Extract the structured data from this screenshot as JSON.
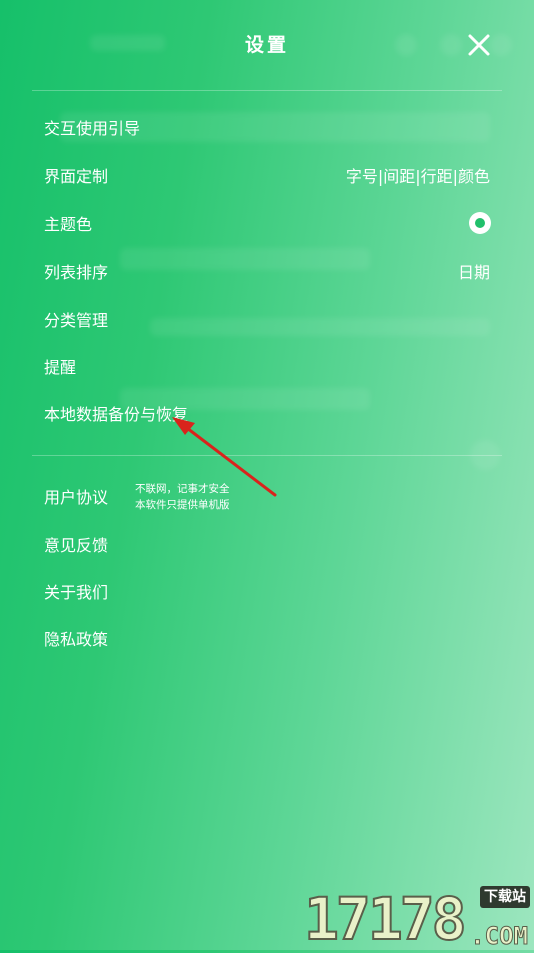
{
  "header": {
    "title": "设置"
  },
  "settings": {
    "items": [
      {
        "label": "交互使用引导",
        "value": ""
      },
      {
        "label": "界面定制",
        "value": "字号|间距|行距|颜色"
      },
      {
        "label": "主题色",
        "value": ""
      },
      {
        "label": "列表排序",
        "value": "日期"
      },
      {
        "label": "分类管理",
        "value": ""
      },
      {
        "label": "提醒",
        "value": ""
      },
      {
        "label": "本地数据备份与恢复",
        "value": ""
      }
    ]
  },
  "about": {
    "items": [
      {
        "label": "用户协议"
      },
      {
        "label": "意见反馈"
      },
      {
        "label": "关于我们"
      },
      {
        "label": "隐私政策"
      }
    ],
    "note_line1": "不联网，记事才安全",
    "note_line2": "本软件只提供单机版"
  },
  "theme": {
    "accent": "#21c06b"
  },
  "watermark": {
    "number": "17178",
    "domain": ".COM",
    "tag": "下载站"
  },
  "icons": {
    "close": "close-icon",
    "theme": "radio-selected-icon",
    "annotation": "red-arrow-icon"
  }
}
